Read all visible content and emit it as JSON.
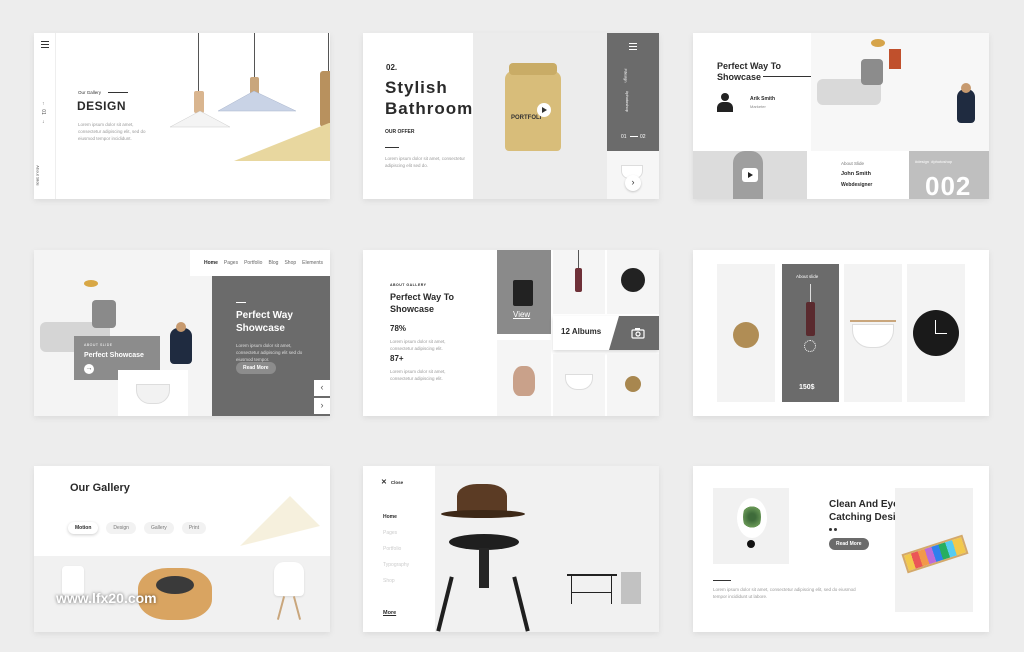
{
  "watermark": "www.lfx20.com",
  "s1": {
    "menu_icon": "hamburger-icon",
    "pager_up": "↑",
    "pager_num": "01",
    "pager_down": "↓",
    "side_label": "About Slide",
    "eyebrow": "Our Gallery",
    "title": "DESIGN",
    "lorem": "Lorem ipsum dolor sit amet, consectetur adipiscing elit, sed do eiusmod tempor incididunt."
  },
  "s2": {
    "num": "02.",
    "title_line1": "Stylish",
    "title_line2": "Bathroom",
    "subtitle": "OUR OFFER",
    "lorem": "Lorem ipsum dolor sit amet, consectetur adipiscing elit sed do.",
    "jar_text": "PORTFOLI",
    "panel_a": "#design",
    "panel_b": "#photoshop",
    "counter_start": "01",
    "counter_end": "02",
    "next": "›"
  },
  "s3": {
    "title_line1": "Perfect Way To",
    "title_line2": "Showcase",
    "person_name": "Arik Smith",
    "person_role": "Marketer",
    "about": "About Slide",
    "name2": "John Smith",
    "role2": "Webdesigner",
    "tags": "#design  #photoshop",
    "big_num": "002"
  },
  "s4": {
    "nav": [
      "Home",
      "Pages",
      "Portfolio",
      "Blog",
      "Shop",
      "Elements"
    ],
    "title_line1": "Perfect Way",
    "title_line2": "Showcase",
    "lorem": "Lorem ipsum dolor sit amet, consectetur adipiscing elit sed do eiusmod tempor.",
    "read_more": "Read More",
    "card_eyebrow": "ABOUT SLIDE",
    "card_title": "Perfect Showcase",
    "prev": "‹",
    "next": "›"
  },
  "s5": {
    "eyebrow": "ABOUT GALLERY",
    "title_line1": "Perfect Way To",
    "title_line2": "Showcase",
    "stat1": "78%",
    "stat2": "87+",
    "lorem": "Lorem ipsum dolor sit amet, consectetur adipiscing elit.",
    "view": "View",
    "albums": "12 Albums"
  },
  "s6": {
    "about": "About slide",
    "price": "150$"
  },
  "s7": {
    "title": "Our Gallery",
    "tabs": [
      "Motion",
      "Design",
      "Gallery",
      "Print"
    ]
  },
  "s8": {
    "close": "Close",
    "menu": [
      "Home",
      "Pages",
      "Portfolio",
      "Typography",
      "Shop"
    ],
    "more": "More"
  },
  "s9": {
    "title_line1": "Clean And Eye",
    "title_line2": "Catching Desing As It",
    "read_more": "Read More",
    "lorem": "Lorem ipsum dolor sit amet, consectetur adipiscing elit, sed do eiusmod tempor incididunt ut labore."
  }
}
